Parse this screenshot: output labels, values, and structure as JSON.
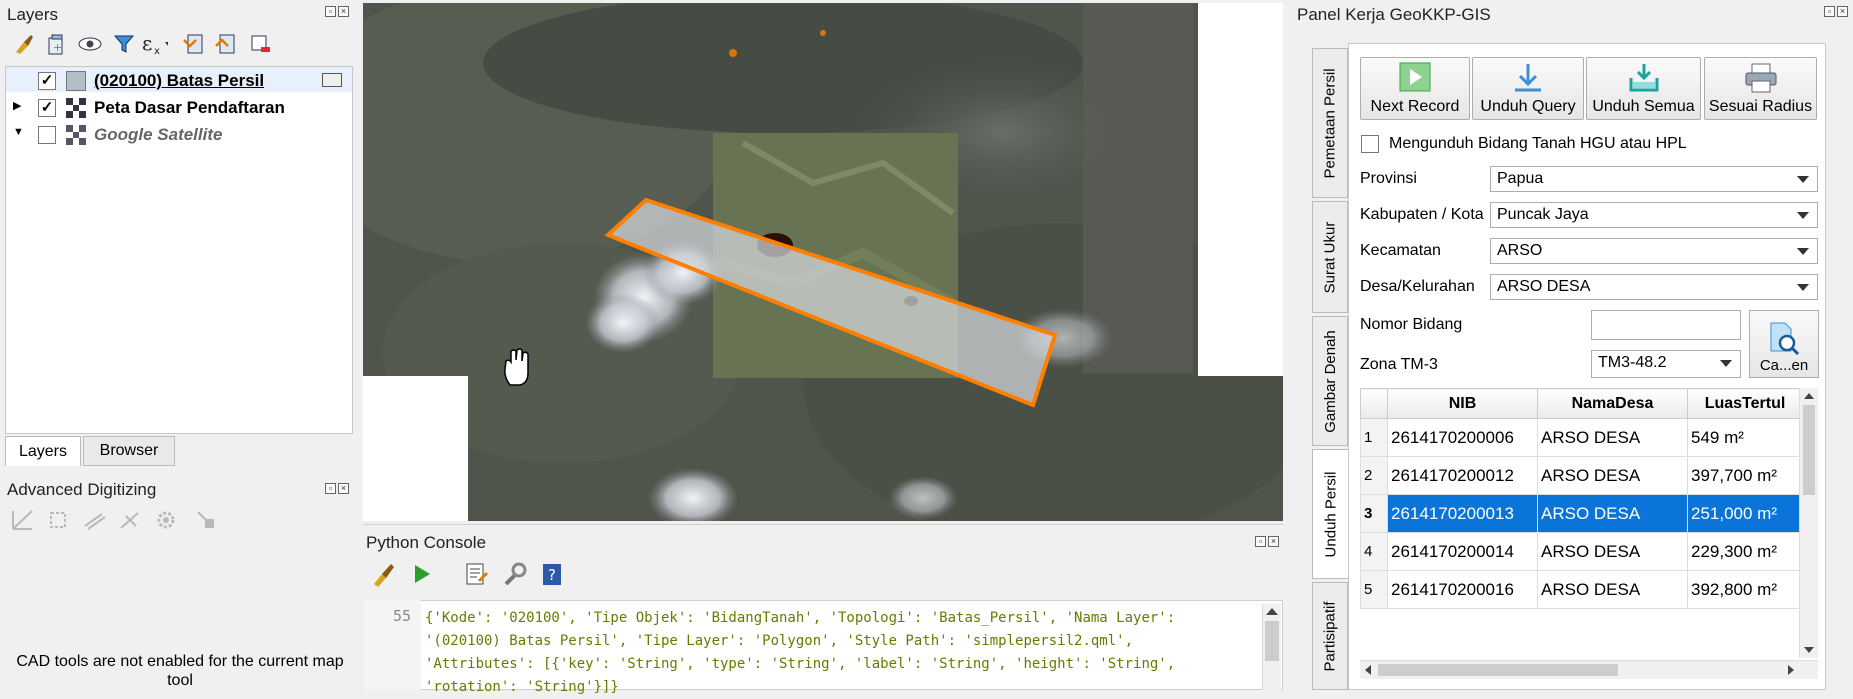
{
  "layers_panel": {
    "title": "Layers",
    "layers": [
      {
        "label": "(020100) Batas Persil",
        "checked": true,
        "style": "bold-underline"
      },
      {
        "label": "Peta Dasar Pendaftaran",
        "checked": true,
        "style": "bold"
      },
      {
        "label": "Google Satellite",
        "checked": false,
        "style": "italic-gray"
      }
    ],
    "bottom_tabs": [
      "Layers",
      "Browser"
    ]
  },
  "advanced_digitizing": {
    "title": "Advanced Digitizing",
    "message": "CAD tools are not enabled for the current map tool"
  },
  "python_console": {
    "title": "Python Console",
    "line_number": "55",
    "code": "{'Kode': '020100', 'Tipe Objek': 'BidangTanah', 'Topologi': 'Batas_Persil', 'Nama Layer': '(020100) Batas Persil', 'Tipe Layer': 'Polygon', 'Style Path': 'simplepersil2.qml', 'Attributes': [{'key': 'String', 'type': 'String', 'label': 'String', 'height': 'String', 'rotation': 'String'}]}"
  },
  "geokkp_panel": {
    "title": "Panel Kerja GeoKKP-GIS",
    "vertical_tabs": [
      "Pemetaan Persil",
      "Surat Ukur",
      "Gambar Denah",
      "Unduh Persil",
      "Partisipatif"
    ],
    "buttons": [
      "Next Record",
      "Unduh Query",
      "Unduh Semua",
      "Sesuai Radius"
    ],
    "checkbox_label": "Mengunduh Bidang Tanah HGU atau HPL",
    "fields": {
      "provinsi_label": "Provinsi",
      "provinsi_value": "Papua",
      "kabupaten_label": "Kabupaten / Kota",
      "kabupaten_value": "Puncak Jaya",
      "kecamatan_label": "Kecamatan",
      "kecamatan_value": "ARSO",
      "desa_label": "Desa/Kelurahan",
      "desa_value": "ARSO DESA",
      "nomor_label": "Nomor Bidang",
      "nomor_value": "",
      "zona_label": "Zona TM-3",
      "zona_value": "TM3-48.2"
    },
    "search_button": "Ca...en",
    "table": {
      "columns": [
        "NIB",
        "NamaDesa",
        "LuasTertul"
      ],
      "rows": [
        {
          "n": "1",
          "nib": "2614170200006",
          "desa": "ARSO DESA",
          "luas": "549 m²"
        },
        {
          "n": "2",
          "nib": "2614170200012",
          "desa": "ARSO DESA",
          "luas": "397,700 m²"
        },
        {
          "n": "3",
          "nib": "2614170200013",
          "desa": "ARSO DESA",
          "luas": "251,000 m²"
        },
        {
          "n": "4",
          "nib": "2614170200014",
          "desa": "ARSO DESA",
          "luas": "229,300 m²"
        },
        {
          "n": "5",
          "nib": "2614170200016",
          "desa": "ARSO DESA",
          "luas": "392,800 m²"
        }
      ],
      "selected_row": 3
    }
  },
  "colors": {
    "selection": "#0a74d8",
    "polygon_stroke": "#ff7f00"
  }
}
